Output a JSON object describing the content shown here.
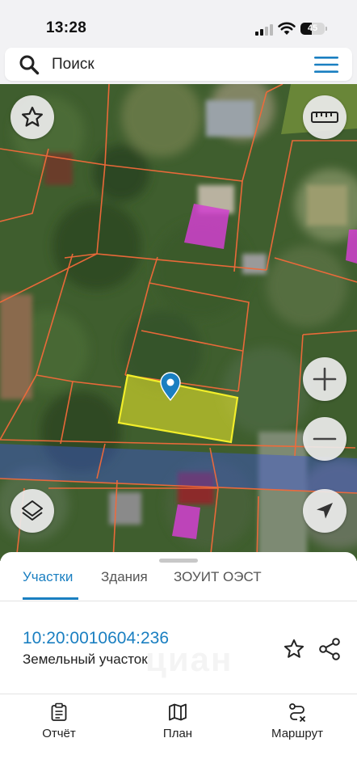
{
  "status_bar": {
    "time": "13:28",
    "battery": "45",
    "battery_level": 0.45
  },
  "search": {
    "placeholder": "Поиск"
  },
  "map": {
    "highlight_color": "#f2ee2a",
    "parcel_border_color": "#f26a3a",
    "building_color": "#d23fd0",
    "zone_color": "#3b55d6"
  },
  "map_controls": {
    "favorite": "star-icon",
    "measure": "ruler-icon",
    "zoom_in": "plus-icon",
    "zoom_out": "minus-icon",
    "layers": "layers-icon",
    "locate": "navigation-arrow-icon"
  },
  "tabs": [
    {
      "label": "Участки",
      "active": true
    },
    {
      "label": "Здания",
      "active": false
    },
    {
      "label": "ЗОУИТ ОЭСТ",
      "active": false
    }
  ],
  "parcel": {
    "cadastral_number": "10:20:0010604:236",
    "type": "Земельный участок"
  },
  "watermark": "циан",
  "bottom_nav": [
    {
      "label": "Отчёт",
      "icon": "clipboard-icon"
    },
    {
      "label": "План",
      "icon": "map-icon"
    },
    {
      "label": "Маршрут",
      "icon": "route-icon"
    }
  ],
  "colors": {
    "accent": "#1a7fc1"
  }
}
